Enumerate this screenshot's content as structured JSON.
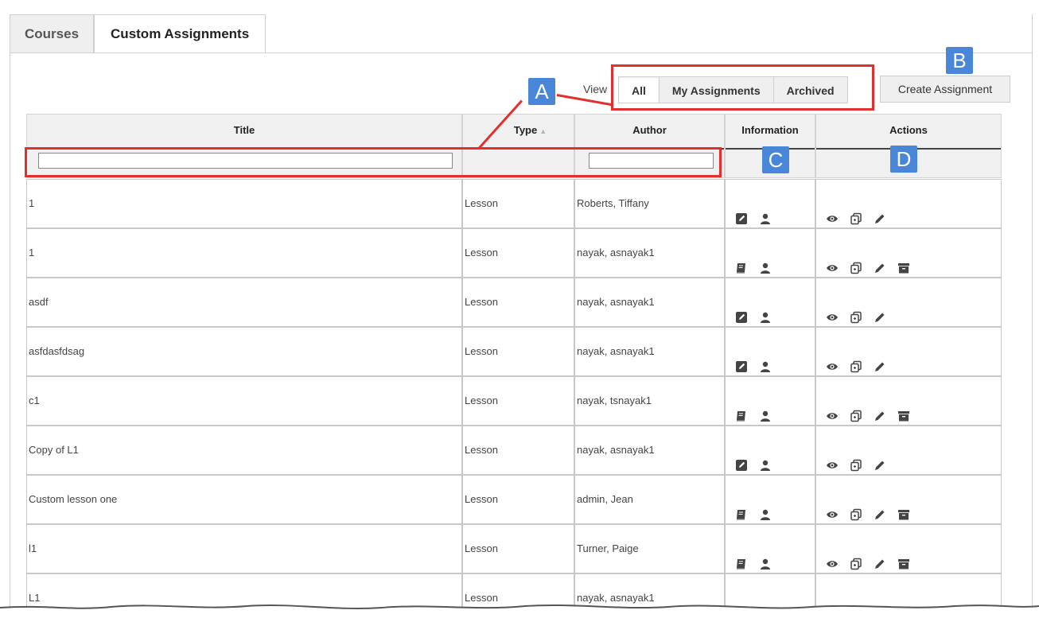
{
  "tabs": [
    {
      "label": "Courses",
      "active": false
    },
    {
      "label": "Custom Assignments",
      "active": true
    }
  ],
  "view": {
    "label": "View",
    "options": [
      {
        "label": "All",
        "active": true
      },
      {
        "label": "My Assignments",
        "active": false
      },
      {
        "label": "Archived",
        "active": false
      }
    ]
  },
  "create_button": "Create Assignment",
  "columns": [
    {
      "key": "title",
      "label": "Title"
    },
    {
      "key": "type",
      "label": "Type",
      "sorted": "ascending"
    },
    {
      "key": "author",
      "label": "Author"
    },
    {
      "key": "information",
      "label": "Information"
    },
    {
      "key": "actions",
      "label": "Actions"
    }
  ],
  "filters": {
    "title": "",
    "author": ""
  },
  "rows": [
    {
      "title": "1",
      "type": "Lesson",
      "author": "Roberts, Tiffany",
      "info_icon": "pencil-box-icon",
      "archive": false
    },
    {
      "title": "1",
      "type": "Lesson",
      "author": "nayak, asnayak1",
      "info_icon": "book-icon",
      "archive": true
    },
    {
      "title": "asdf",
      "type": "Lesson",
      "author": "nayak, asnayak1",
      "info_icon": "pencil-box-icon",
      "archive": false
    },
    {
      "title": "asfdasfdsag",
      "type": "Lesson",
      "author": "nayak, asnayak1",
      "info_icon": "pencil-box-icon",
      "archive": false
    },
    {
      "title": "c1",
      "type": "Lesson",
      "author": "nayak, tsnayak1",
      "info_icon": "book-icon",
      "archive": true
    },
    {
      "title": "Copy of L1",
      "type": "Lesson",
      "author": "nayak, asnayak1",
      "info_icon": "pencil-box-icon",
      "archive": false
    },
    {
      "title": "Custom lesson one",
      "type": "Lesson",
      "author": "admin, Jean",
      "info_icon": "book-icon",
      "archive": true
    },
    {
      "title": "l1",
      "type": "Lesson",
      "author": "Turner, Paige",
      "info_icon": "book-icon",
      "archive": true
    },
    {
      "title": "L1",
      "type": "Lesson",
      "author": "nayak, asnayak1",
      "info_icon": "book-icon",
      "archive": true
    }
  ],
  "annotations": {
    "a": "A",
    "b": "B",
    "c": "C",
    "d": "D"
  },
  "colors": {
    "annotation_red": "#e0312f",
    "badge_blue": "#4a86d8",
    "header_bg": "#f0f0f0"
  }
}
